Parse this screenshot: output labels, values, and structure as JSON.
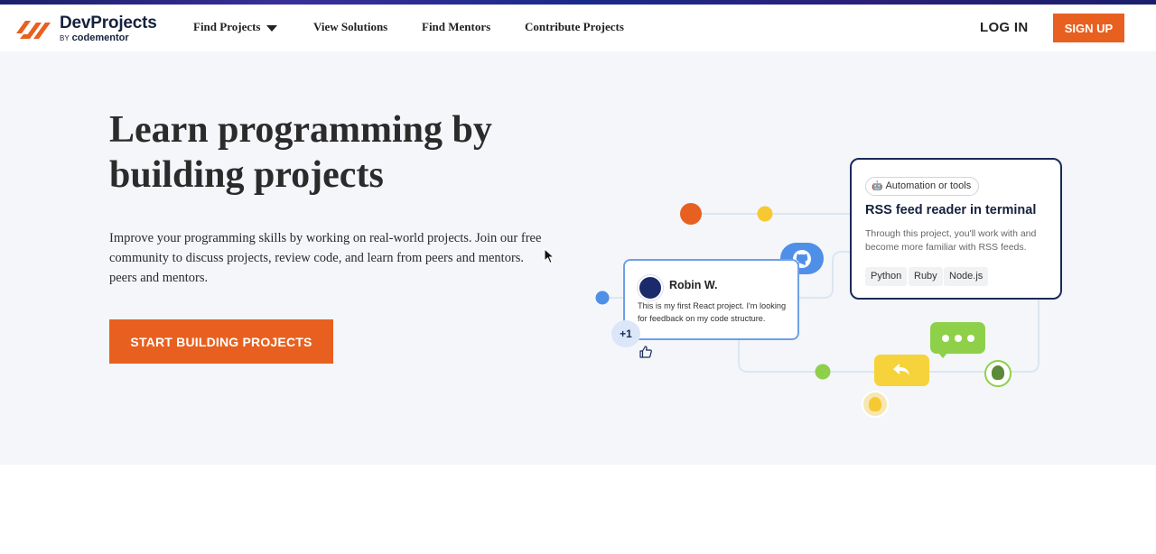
{
  "brand": {
    "name": "DevProjects",
    "by": "BY",
    "sub": "codementor",
    "accent": "#e8601f",
    "navy": "#15213d"
  },
  "nav": {
    "find_projects": "Find Projects",
    "view_solutions": "View Solutions",
    "find_mentors": "Find Mentors",
    "contribute_projects": "Contribute Projects",
    "login": "LOG IN",
    "signup": "SIGN UP"
  },
  "hero": {
    "headline": "Learn programming by building projects",
    "subtext": "Improve your programming skills by working on real-world projects. Join our free community to discuss projects, review code, and learn from peers and mentors. peers and mentors.",
    "cta": "START BUILDING PROJECTS"
  },
  "project_card": {
    "tag": "Automation or tools",
    "tag_icon": "robot-icon",
    "title": "RSS feed reader in terminal",
    "description": "Through this project, you'll work with and become more familiar with RSS feeds.",
    "chips": [
      "Python",
      "Ruby",
      "Node.js"
    ]
  },
  "comment_card": {
    "name": "Robin W.",
    "text": "This is my first React project. I'm looking for feedback on my code structure.",
    "badge": "+1"
  },
  "icons": [
    "github-icon",
    "thumbs-up-icon",
    "reply-icon",
    "chat-bubble-icon",
    "avatar-icon",
    "caret-down-icon"
  ]
}
